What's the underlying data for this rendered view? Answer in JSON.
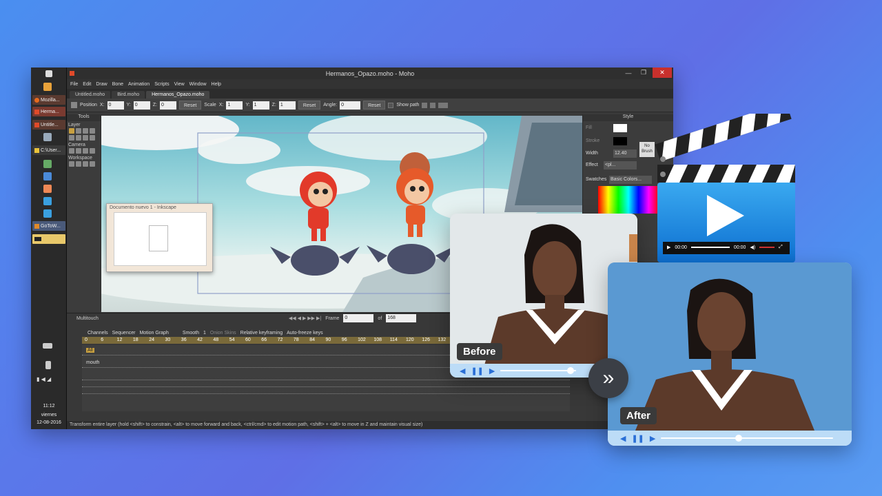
{
  "window": {
    "title": "Hermanos_Opazo.moho - Moho",
    "menu": [
      "File",
      "Edit",
      "Draw",
      "Bone",
      "Animation",
      "Scripts",
      "View",
      "Window",
      "Help"
    ],
    "file_tabs": [
      "Untitled.moho",
      "Bird.moho",
      "Hermanos_Opazo.moho"
    ]
  },
  "taskbar": {
    "items": [
      "Mozilla...",
      "Herma...",
      "Untitle...",
      "C:\\User...",
      "GoToW..."
    ],
    "clock": "11:12",
    "day": "viernes",
    "date": "12-08-2016"
  },
  "tool_options": {
    "position_label": "Position",
    "x_label": "X:",
    "x_value": "0",
    "y_label": "Y:",
    "y_value": "0",
    "z_label": "Z:",
    "z_value": "0",
    "reset1": "Reset",
    "scale_label": "Scale",
    "sx_label": "X:",
    "sx_value": "1",
    "sy_label": "Y:",
    "sy_value": "1",
    "sz_label": "Z:",
    "sz_value": "1",
    "reset2": "Reset",
    "angle_label": "Angle:",
    "angle_value": "0",
    "reset3": "Reset",
    "show_path": "Show path"
  },
  "tools_panel": {
    "title": "Tools",
    "sections": [
      "Layer",
      "Camera",
      "Workspace"
    ]
  },
  "style_panel": {
    "title": "Style",
    "fill": "Fill",
    "stroke": "Stroke",
    "no_brush": "No Brush",
    "width_label": "Width",
    "width_value": "12.40",
    "effect_label": "Effect",
    "effect_value": "<pl...",
    "swatches_label": "Swatches",
    "swatches_value": "Basic Colors..."
  },
  "inkscape": {
    "title": "Documento nuevo 1 - Inkscape"
  },
  "timeline": {
    "multitouch": "Multitouch",
    "frame_label": "Frame",
    "frame_value": "0",
    "of_label": "of",
    "total_frames": "168",
    "tabs": [
      "Channels",
      "Sequencer",
      "Motion Graph"
    ],
    "smooth": "Smooth",
    "smooth_num": "1",
    "onion_skins": "Onion Skins",
    "relative_keyframing": "Relative keyframing",
    "auto_freeze": "Auto-freeze keys",
    "ruler": [
      "0",
      "6",
      "12",
      "18",
      "24",
      "30",
      "36",
      "42",
      "48",
      "54",
      "60",
      "66",
      "72",
      "78",
      "84",
      "90",
      "96",
      "102",
      "108",
      "114",
      "120",
      "126",
      "132"
    ],
    "track_all": "All",
    "track_mouth": "mouth"
  },
  "status": {
    "text": "Transform entire layer (hold <shift> to constrain, <alt> to move forward and back, <ctrl/cmd> to edit motion path, <shift> + <alt> to move in Z and maintain visual size)"
  },
  "player": {
    "time_start": "00:00",
    "time_end": "00:00"
  },
  "before_card": {
    "label": "Before",
    "progress": 0.92
  },
  "after_card": {
    "label": "After",
    "progress": 0.45
  },
  "colors": {
    "accent": "#2a6fd6",
    "control_bar": "#bcdcf7",
    "background_gradient": "#5a78ea"
  }
}
